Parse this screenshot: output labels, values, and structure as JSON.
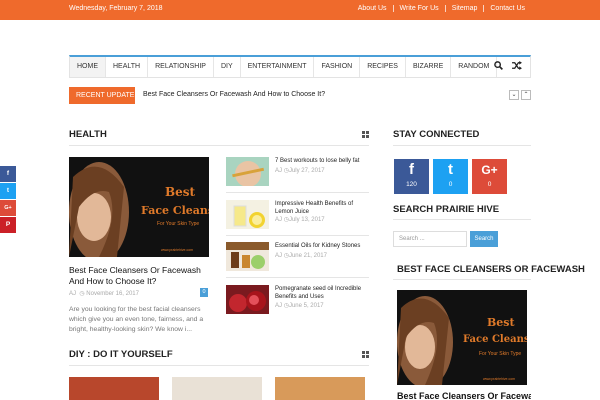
{
  "topbar": {
    "date": "Wednesday, February 7, 2018",
    "links": [
      "About Us",
      "Write For Us",
      "Sitemap",
      "Contact Us"
    ]
  },
  "nav": {
    "items": [
      "HOME",
      "HEALTH",
      "RELATIONSHIP",
      "DIY",
      "ENTERTAINMENT",
      "FASHION",
      "RECIPES",
      "BIZARRE",
      "RANDOM"
    ],
    "tools": [
      "search-icon",
      "shuffle-icon"
    ]
  },
  "ticker": {
    "label": "RECENT UPDATES",
    "text": "Best Face Cleansers Or Facewash And How to Choose It?",
    "prev": "⌄",
    "next": "⌃"
  },
  "health": {
    "title": "HEALTH",
    "featured": {
      "image_title_1": "Best",
      "image_title_2": "Face Cleansers",
      "image_subtitle": "For Your Skin Type",
      "image_watermark": "www.prairiehive.com",
      "title": "Best Face Cleansers Or Facewash And How to Choose It?",
      "author": "AJ",
      "date": "November 16, 2017",
      "comments": "0",
      "excerpt": "Are you looking for the best facial cleansers which give you an even tone, fairness, and a bright, healthy-looking skin? We know i..."
    },
    "posts": [
      {
        "title": "7 Best workouts to lose belly fat",
        "author": "AJ",
        "date": "July 27, 2017"
      },
      {
        "title": "Impressive Health Benefits of Lemon Juice",
        "author": "AJ",
        "date": "July 13, 2017"
      },
      {
        "title": "Essential Oils for Kidney Stones",
        "author": "AJ",
        "date": "June 21, 2017"
      },
      {
        "title": "Pomegranate seed oil Incredible Benefits and Uses",
        "author": "AJ",
        "date": "June 5, 2017"
      }
    ]
  },
  "diy": {
    "title": "DIY : DO IT YOURSELF"
  },
  "share": [
    "f",
    "t",
    "G+",
    "P"
  ],
  "stay_connected": {
    "title": "STAY CONNECTED",
    "facebook": {
      "glyph": "f",
      "count": "120"
    },
    "twitter": {
      "glyph": "t",
      "count": "0"
    },
    "google": {
      "glyph": "G+",
      "count": "0"
    }
  },
  "search": {
    "title": "SEARCH PRAIRIE HIVE",
    "placeholder": "Search ...",
    "button": "Search"
  },
  "editors_pick": {
    "title": "Best Face Cleansers Or Facewash",
    "image_title_1": "Best",
    "image_title_2": "Face Cleansers",
    "image_subtitle": "For Your Skin Type",
    "image_watermark": "www.prairiehive.com"
  },
  "colors": {
    "accent": "#ef6a2c",
    "link_blue": "#4a9fd8",
    "facebook": "#3b5998",
    "twitter": "#1da1f2",
    "google": "#dd4b39",
    "pinterest": "#cb2027"
  }
}
